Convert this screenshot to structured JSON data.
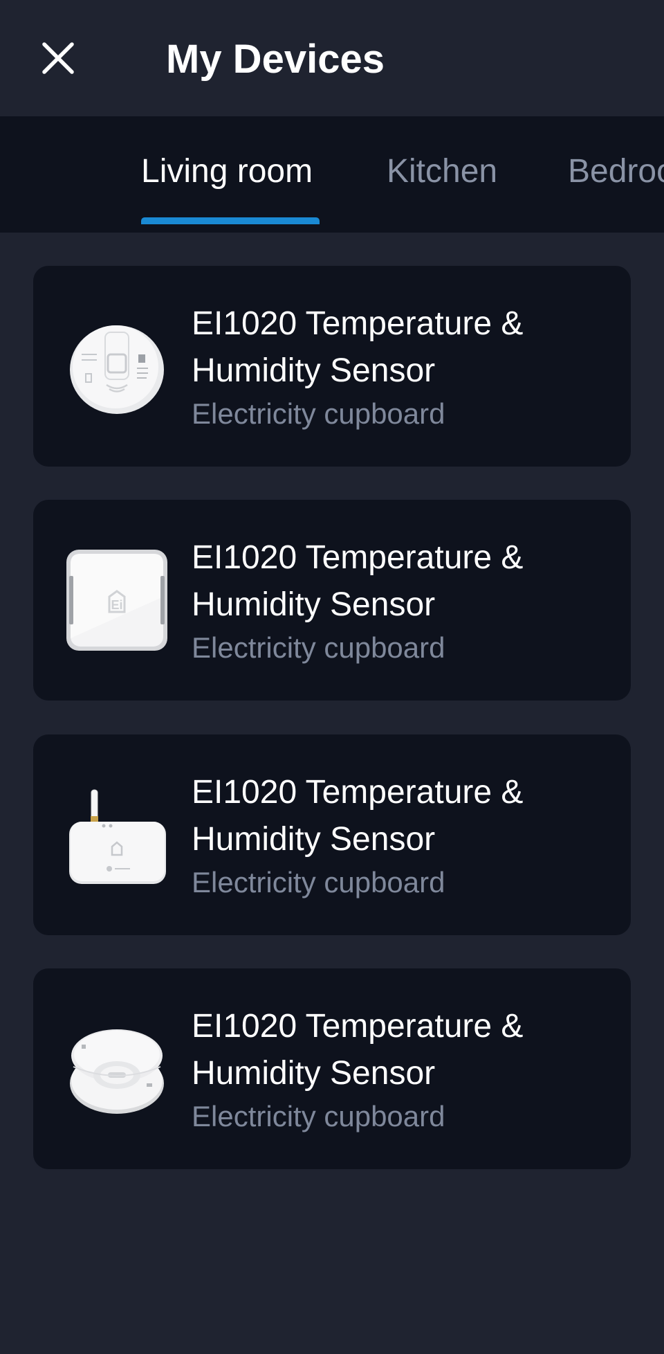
{
  "header": {
    "close_icon": "close-icon",
    "title": "My Devices"
  },
  "tabs": [
    {
      "label": "Living room",
      "active": true
    },
    {
      "label": "Kitchen",
      "active": false
    },
    {
      "label": "Bedroom",
      "active": false
    }
  ],
  "devices": [
    {
      "name": "EI1020 Temperature & Humidity Sensor",
      "location": "Electricity cupboard",
      "image_icon": "round-sensor-icon"
    },
    {
      "name": "EI1020 Temperature & Humidity Sensor",
      "location": "Electricity cupboard",
      "image_icon": "square-sensor-icon"
    },
    {
      "name": "EI1020 Temperature & Humidity Sensor",
      "location": "Electricity cupboard",
      "image_icon": "gateway-hub-icon"
    },
    {
      "name": "EI1020 Temperature & Humidity Sensor",
      "location": "Electricity cupboard",
      "image_icon": "smoke-alarm-icon"
    }
  ],
  "colors": {
    "background": "#1f2330",
    "tabbar_background": "#0e121d",
    "card_background": "#0e121d",
    "accent": "#1a8ad4",
    "muted_text": "#7f889b"
  }
}
